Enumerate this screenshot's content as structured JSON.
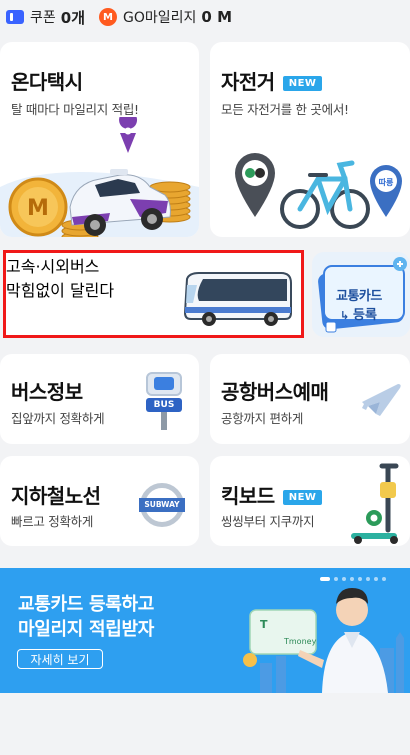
{
  "topbar": {
    "coupon_label": "쿠폰",
    "coupon_value": "0개",
    "mileage_label": "GO마일리지",
    "mileage_value": "0 M",
    "mileage_icon_letter": "M"
  },
  "cards": {
    "taxi": {
      "title": "온다택시",
      "subtitle": "탈 때마다 마일리지 적립!"
    },
    "bike": {
      "title": "자전거",
      "badge": "NEW",
      "subtitle": "모든 자전거를 한 곳에서!"
    },
    "express_bus": {
      "title": "고속·시외버스",
      "subtitle": "막힘없이 달린다"
    },
    "transit_card_promo": {
      "line1": "교통카드",
      "line2": "등록"
    },
    "bus_info": {
      "title": "버스정보",
      "subtitle": "집앞까지 정확하게",
      "sign": "BUS"
    },
    "airport_bus": {
      "title": "공항버스예매",
      "subtitle": "공항까지 편하게"
    },
    "subway": {
      "title": "지하철노선",
      "subtitle": "빠르고 정확하게",
      "sign": "SUBWAY"
    },
    "kickboard": {
      "title": "킥보드",
      "badge": "NEW",
      "subtitle": "씽씽부터 지쿠까지"
    }
  },
  "banner": {
    "line1": "교통카드 등록하고",
    "line2": "마일리지 적립받자",
    "button": "자세히 보기",
    "card_brand": "Tmoney",
    "card_letter": "T"
  },
  "colors": {
    "accent_blue": "#2e9ff0",
    "highlight_red": "#f01818",
    "new_badge": "#2aa6ea"
  }
}
